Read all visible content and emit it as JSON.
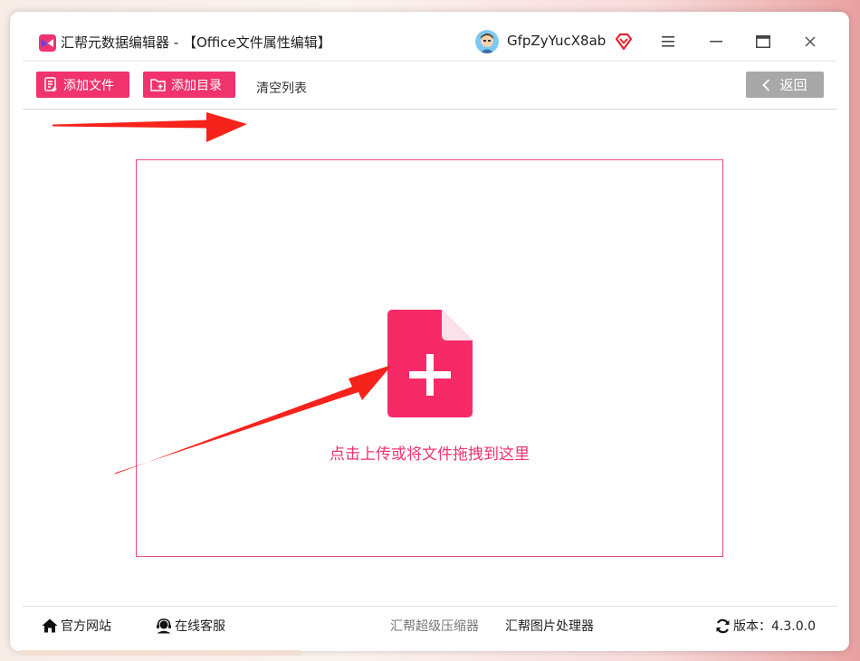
{
  "window": {
    "title": "汇帮元数据编辑器 - 【Office文件属性编辑】",
    "username": "GfpZyYucX8ab"
  },
  "toolbar": {
    "add_file": "添加文件",
    "add_dir": "添加目录",
    "clear_list": "清空列表",
    "back": "返回"
  },
  "dropzone": {
    "text": "点击上传或将文件拖拽到这里",
    "icon": "file-plus-icon"
  },
  "footer": {
    "official_site": "官方网站",
    "online_service": "在线客服",
    "compressor": "汇帮超级压缩器",
    "image_processor": "汇帮图片处理器",
    "version": "版本：4.3.0.0"
  },
  "colors": {
    "accent": "#f0336d",
    "back_button": "#a8a8a8",
    "annotation_arrow": "#f5231b"
  },
  "icons": [
    "app-logo-icon",
    "avatar-icon",
    "vip-diamond-icon",
    "menu-icon",
    "minimize-icon",
    "maximize-icon",
    "close-icon",
    "add-file-icon",
    "add-folder-icon",
    "chevron-left-icon",
    "file-plus-icon",
    "home-icon",
    "headset-icon",
    "refresh-icon"
  ]
}
